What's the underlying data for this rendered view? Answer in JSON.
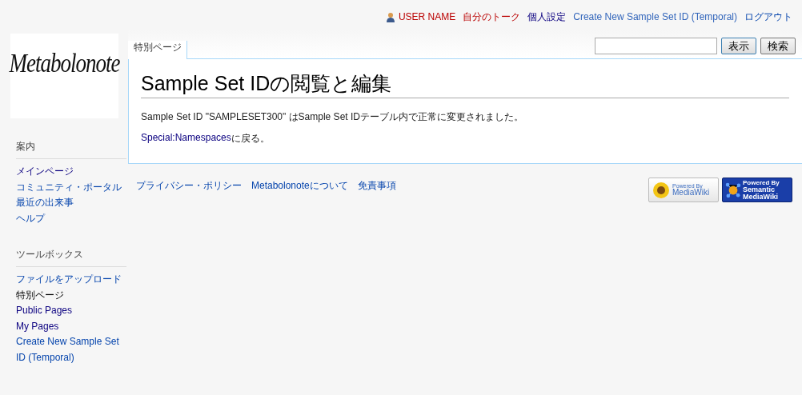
{
  "personal_bar": [
    {
      "label": "USER NAME",
      "kind": "new",
      "user_icon": true
    },
    {
      "label": "自分のトーク",
      "kind": "new",
      "user_icon": false
    },
    {
      "label": "個人設定",
      "kind": "visited",
      "user_icon": false
    },
    {
      "label": "Create New Sample Set ID (Temporal)",
      "kind": "external",
      "user_icon": false
    },
    {
      "label": "ログアウト",
      "kind": "link",
      "user_icon": false
    }
  ],
  "logo": {
    "text": "Metabolonote"
  },
  "sidebar": [
    {
      "heading": "案内",
      "items": [
        {
          "label": "メインページ",
          "kind": "visited"
        },
        {
          "label": "コミュニティ・ポータル",
          "kind": "link"
        },
        {
          "label": "最近の出来事",
          "kind": "link"
        },
        {
          "label": "ヘルプ",
          "kind": "link"
        }
      ]
    },
    {
      "heading": "ツールボックス",
      "items": [
        {
          "label": "ファイルをアップロード",
          "kind": "link"
        },
        {
          "label": "特別ページ",
          "kind": "current"
        },
        {
          "label": "Public Pages",
          "kind": "visited"
        },
        {
          "label": "My Pages",
          "kind": "visited"
        },
        {
          "label": "Create New Sample Set ID (Temporal)",
          "kind": "link"
        }
      ]
    }
  ],
  "tabs": [
    {
      "label": "特別ページ",
      "selected": true
    }
  ],
  "search": {
    "go_button": "表示",
    "search_button": "検索"
  },
  "page": {
    "title": "Sample Set IDの閲覧と編集",
    "message": "Sample Set ID \"SAMPLESET300\" はSample Set IDテーブル内で正常に変更されました。",
    "return_link": "Special:Namespaces",
    "return_suffix": "に戻る。"
  },
  "footer": {
    "links": [
      "プライバシー・ポリシー",
      "Metabolonoteについて",
      "免責事項"
    ],
    "badges": [
      {
        "kind": "mediawiki",
        "top": "Powered By",
        "bottom": "MediaWiki"
      },
      {
        "kind": "semantic",
        "top": "Powered By",
        "bottom": "Semantic MediaWiki"
      }
    ]
  }
}
